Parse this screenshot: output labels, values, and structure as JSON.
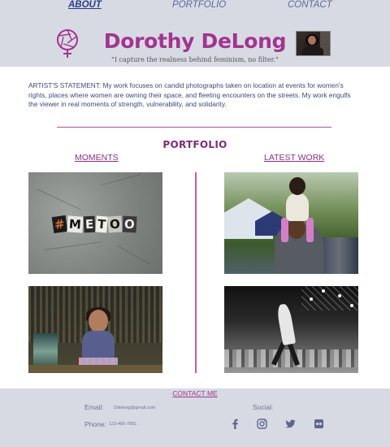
{
  "nav": {
    "about": "ABOUT",
    "portfolio": "PORTFOLIO",
    "contact": "CONTACT"
  },
  "header": {
    "title": "Dorothy DeLong",
    "tagline": "\"I capture the realness behind feminism, no filter.\""
  },
  "statement": "ARTIST'S STATEMENT:  My work focuses on candid photographs taken on location at events for women's rights, places where women are owning their space, and fleeting encounters on the streets. My work engulfs the viewer in real moments of strength, vulnerability, and solidarity.",
  "portfolio": {
    "title": "PORTFOLIO",
    "col_left": "MOMENTS",
    "col_right": "LATEST WORK",
    "metoo_letters": [
      "#",
      "M",
      "E",
      "T",
      "O",
      "O"
    ]
  },
  "footer": {
    "contact_link": "CONTACT ME",
    "email_label": "Email:",
    "email_value": "Ddelong@gmail.com",
    "phone_label": "Phone:",
    "phone_value": "123-456-7891",
    "social_label": "Social:",
    "icons": [
      "facebook-icon",
      "instagram-icon",
      "twitter-icon",
      "flickr-icon"
    ]
  },
  "colors": {
    "brand_magenta": "#a1358f",
    "nav_blue": "#2c3b8c",
    "header_bg": "#d8dae3",
    "statement_text": "#3b4a78"
  }
}
